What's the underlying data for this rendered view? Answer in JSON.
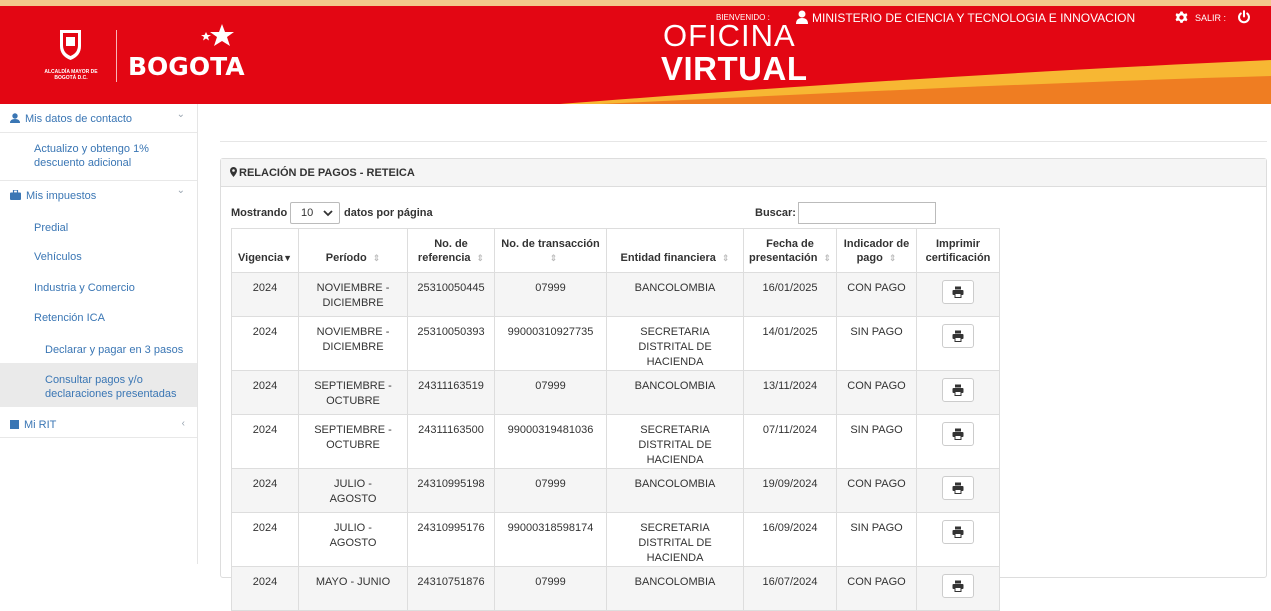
{
  "header": {
    "logo_caption": "ALCALDÍA MAYOR DE BOGOTÁ D.C.",
    "brand": "BOGOTA",
    "title_line1": "OFICINA",
    "title_line2": "VIRTUAL",
    "welcome": "BIENVENIDO :",
    "user_name": "MINISTERIO DE CIENCIA Y TECNOLOGIA E INNOVACION",
    "logout": "SALIR :"
  },
  "sidebar": {
    "items": [
      {
        "label": "Mis datos de contacto",
        "icon": "user-icon"
      },
      {
        "label": "Actualizo y obtengo 1% descuento adicional"
      },
      {
        "label": "Mis impuestos",
        "icon": "briefcase-icon"
      },
      {
        "label": "Predial"
      },
      {
        "label": "Vehículos"
      },
      {
        "label": "Industria y Comercio"
      },
      {
        "label": "Retención ICA"
      },
      {
        "label": "Declarar y pagar en 3 pasos"
      },
      {
        "label": "Consultar pagos y/o declaraciones presentadas"
      },
      {
        "label": "Mi RIT",
        "icon": "book-icon"
      }
    ]
  },
  "panel": {
    "title": "RELACIÓN DE PAGOS - RETEICA",
    "length_prefix": "Mostrando",
    "length_value": "10",
    "length_suffix": "datos por página",
    "search_label": "Buscar:",
    "search_value": ""
  },
  "table": {
    "headers": [
      "Vigencia",
      "Período",
      "No. de referencia",
      "No. de transacción",
      "Entidad financiera",
      "Fecha de presentación",
      "Indicador de pago",
      "Imprimir certificación"
    ],
    "rows": [
      [
        "2024",
        "NOVIEMBRE - DICIEMBRE",
        "25310050445",
        "07999",
        "BANCOLOMBIA",
        "16/01/2025",
        "CON PAGO"
      ],
      [
        "2024",
        "NOVIEMBRE - DICIEMBRE",
        "25310050393",
        "99000310927735",
        "SECRETARIA DISTRITAL DE HACIENDA",
        "14/01/2025",
        "SIN PAGO"
      ],
      [
        "2024",
        "SEPTIEMBRE - OCTUBRE",
        "24311163519",
        "07999",
        "BANCOLOMBIA",
        "13/11/2024",
        "CON PAGO"
      ],
      [
        "2024",
        "SEPTIEMBRE - OCTUBRE",
        "24311163500",
        "99000319481036",
        "SECRETARIA DISTRITAL DE HACIENDA",
        "07/11/2024",
        "SIN PAGO"
      ],
      [
        "2024",
        "JULIO - AGOSTO",
        "24310995198",
        "07999",
        "BANCOLOMBIA",
        "19/09/2024",
        "CON PAGO"
      ],
      [
        "2024",
        "JULIO - AGOSTO",
        "24310995176",
        "99000318598174",
        "SECRETARIA DISTRITAL DE HACIENDA",
        "16/09/2024",
        "SIN PAGO"
      ],
      [
        "2024",
        "MAYO - JUNIO",
        "24310751876",
        "07999",
        "BANCOLOMBIA",
        "16/07/2024",
        "CON PAGO"
      ]
    ]
  },
  "colors": {
    "header_red": "#e30613",
    "link_blue": "#3a76b4"
  }
}
